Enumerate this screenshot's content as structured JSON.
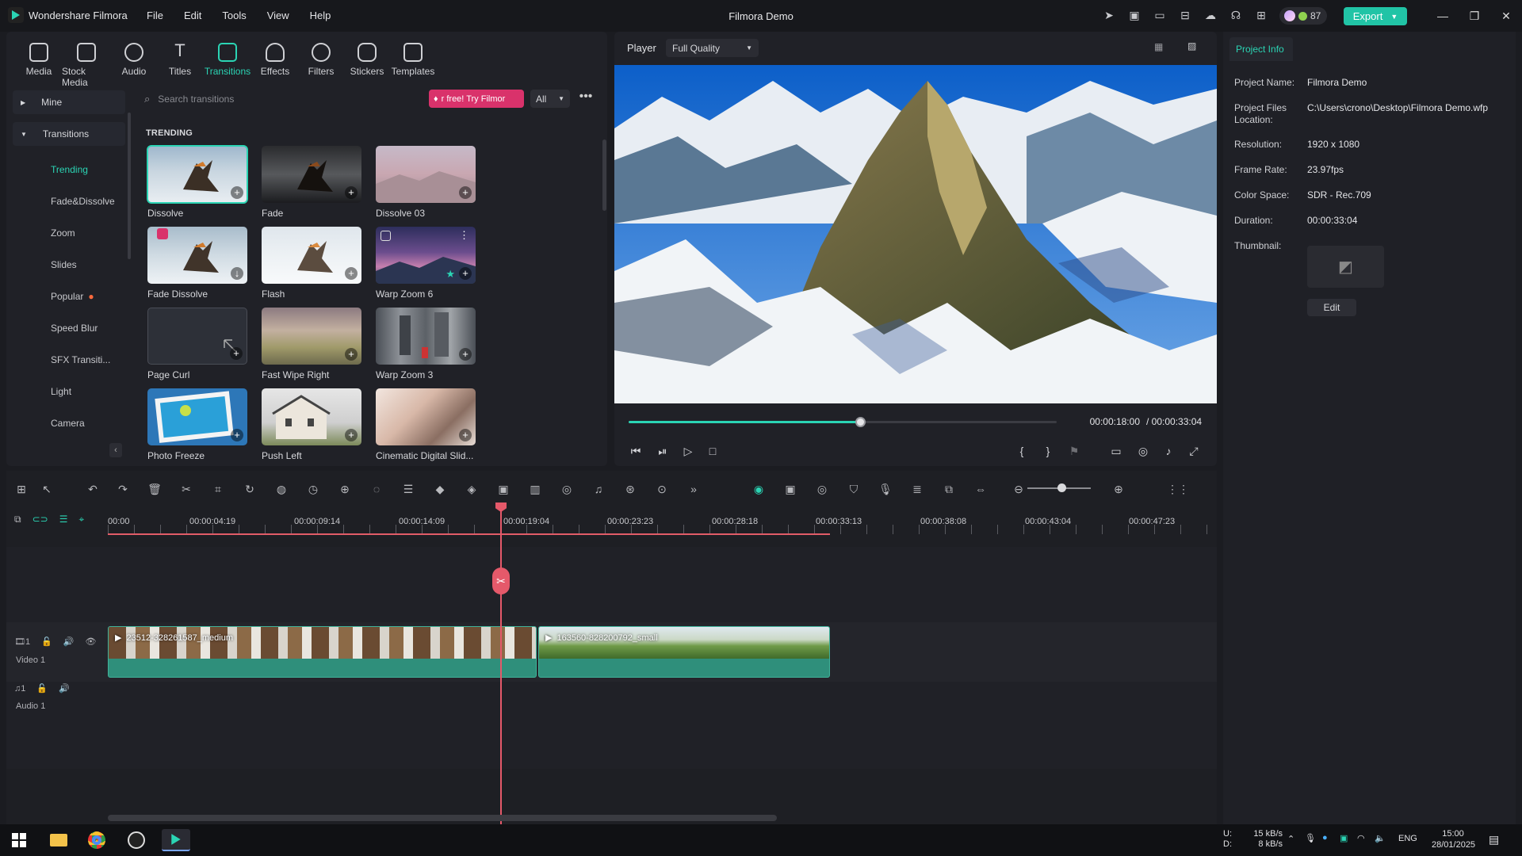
{
  "window": {
    "app_name": "Wondershare Filmora",
    "title": "Filmora Demo",
    "menu": [
      "File",
      "Edit",
      "Tools",
      "View",
      "Help"
    ],
    "credits": "87",
    "export_label": "Export"
  },
  "library": {
    "tabs": [
      {
        "label": "Media",
        "icon": "media-icon"
      },
      {
        "label": "Stock Media",
        "icon": "stock-media-icon"
      },
      {
        "label": "Audio",
        "icon": "audio-icon"
      },
      {
        "label": "Titles",
        "icon": "titles-icon"
      },
      {
        "label": "Transitions",
        "icon": "transitions-icon",
        "active": true
      },
      {
        "label": "Effects",
        "icon": "effects-icon"
      },
      {
        "label": "Filters",
        "icon": "filters-icon"
      },
      {
        "label": "Stickers",
        "icon": "stickers-icon"
      },
      {
        "label": "Templates",
        "icon": "templates-icon"
      }
    ],
    "nav_mine": "Mine",
    "nav_transitions": "Transitions",
    "nav_items": [
      "Trending",
      "Fade&Dissolve",
      "Zoom",
      "Slides",
      "Popular",
      "Speed Blur",
      "SFX Transiti...",
      "Light",
      "Camera"
    ],
    "search_placeholder": "Search transitions",
    "promo": "r free! Try Filmor",
    "filter": "All",
    "section_title": "TRENDING",
    "items": [
      {
        "label": "Dissolve",
        "selected": true
      },
      {
        "label": "Fade"
      },
      {
        "label": "Dissolve 03"
      },
      {
        "label": "Fade Dissolve"
      },
      {
        "label": "Flash"
      },
      {
        "label": "Warp Zoom 6"
      },
      {
        "label": "Page Curl"
      },
      {
        "label": "Fast Wipe Right"
      },
      {
        "label": "Warp Zoom 3"
      },
      {
        "label": "Photo Freeze"
      },
      {
        "label": "Push Left"
      },
      {
        "label": "Cinematic Digital Slid..."
      }
    ]
  },
  "player": {
    "label": "Player",
    "quality": "Full Quality",
    "current_time": "00:00:18:00",
    "total_time": "/ 00:00:33:04",
    "progress": 0.54
  },
  "project_info": {
    "tab": "Project Info",
    "rows": [
      {
        "key": "Project Name:",
        "value": "Filmora Demo"
      },
      {
        "key": "Project Files Location:",
        "value": "C:\\Users\\crono\\Desktop\\Filmora Demo.wfp"
      },
      {
        "key": "Resolution:",
        "value": "1920 x 1080"
      },
      {
        "key": "Frame Rate:",
        "value": "23.97fps"
      },
      {
        "key": "Color Space:",
        "value": "SDR - Rec.709"
      },
      {
        "key": "Duration:",
        "value": "00:00:33:04"
      },
      {
        "key": "Thumbnail:",
        "value": ""
      }
    ],
    "edit_label": "Edit"
  },
  "timeline": {
    "ruler": [
      "00:00",
      "00:00:04:19",
      "00:00:09:14",
      "00:00:14:09",
      "00:00:19:04",
      "00:00:23:23",
      "00:00:28:18",
      "00:00:33:13",
      "00:00:38:08",
      "00:00:43:04",
      "00:00:47:23"
    ],
    "tracks": [
      {
        "name": "Video 1",
        "num": "1"
      },
      {
        "name": "Audio 1",
        "num": "1"
      }
    ],
    "clips": [
      {
        "name": "23512-328261587_medium"
      },
      {
        "name": "163560-828200792_small"
      }
    ]
  },
  "taskbar": {
    "net_up": "15 kB/s",
    "net_down": "8 kB/s",
    "drive_u": "U:",
    "drive_d": "D:",
    "lang": "ENG",
    "time": "15:00",
    "date": "28/01/2025"
  },
  "colors": {
    "accent": "#2bd4b4",
    "playhead": "#e5596a",
    "export": "#21c4a6",
    "promo": "#d9326b"
  }
}
